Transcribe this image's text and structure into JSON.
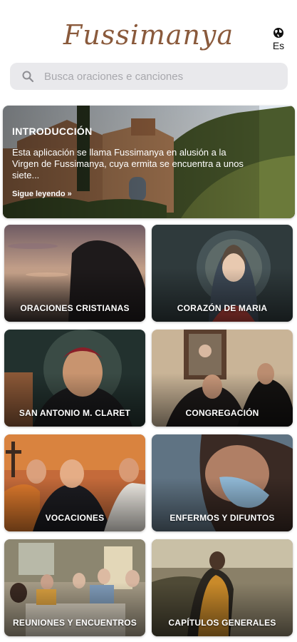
{
  "header": {
    "logo": "Fussimanya",
    "language": "Es"
  },
  "search": {
    "placeholder": "Busca oraciones e canciones"
  },
  "intro": {
    "title": "INTRODUCCIÓN",
    "text": "Esta aplicación se llama Fussimanya en alusión a la Virgen de Fussimanya, cuya ermita se encuentra a unos siete...",
    "more": "Sigue leyendo »"
  },
  "categories": [
    {
      "label": "ORACIONES CRISTIANAS"
    },
    {
      "label": "CORAZÓN DE MARIA"
    },
    {
      "label": "SAN ANTONIO M. CLARET"
    },
    {
      "label": "CONGREGACIÓN"
    },
    {
      "label": "VOCACIONES"
    },
    {
      "label": "ENFERMOS Y DIFUNTOS"
    },
    {
      "label": "REUNIONES Y ENCUENTROS"
    },
    {
      "label": "CAPÍTULOS GENERALES"
    }
  ],
  "colors": {
    "logo": "#8a5a3c",
    "search_bg": "#e9e9ec"
  }
}
